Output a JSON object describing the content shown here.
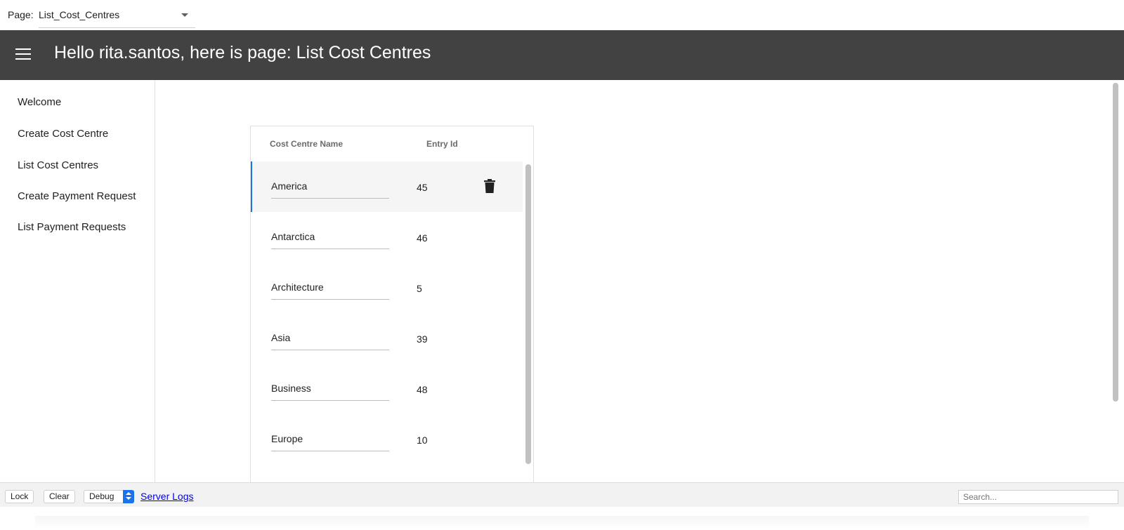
{
  "page_selector": {
    "label": "Page:",
    "value": "List_Cost_Centres"
  },
  "header": {
    "title": "Hello rita.santos, here is page: List Cost Centres",
    "background": "#424242"
  },
  "sidebar": {
    "items": [
      {
        "label": "Welcome"
      },
      {
        "label": "Create Cost Centre"
      },
      {
        "label": "List Cost Centres"
      },
      {
        "label": "Create Payment Request"
      },
      {
        "label": "List Payment Requests"
      }
    ]
  },
  "grid": {
    "columns": [
      "Cost Centre Name",
      "Entry Id"
    ],
    "rows": [
      {
        "name": "America",
        "id": "45",
        "selected": true
      },
      {
        "name": "Antarctica",
        "id": "46"
      },
      {
        "name": "Architecture",
        "id": "5"
      },
      {
        "name": "Asia",
        "id": "39"
      },
      {
        "name": "Business",
        "id": "48"
      },
      {
        "name": "Europe",
        "id": "10"
      }
    ],
    "selected_accent": "#1a73e8"
  },
  "debug_bar": {
    "lock_label": "Lock",
    "clear_label": "Clear",
    "level_value": "Debug",
    "server_logs_label": "Server Logs",
    "search_placeholder": "Search..."
  }
}
